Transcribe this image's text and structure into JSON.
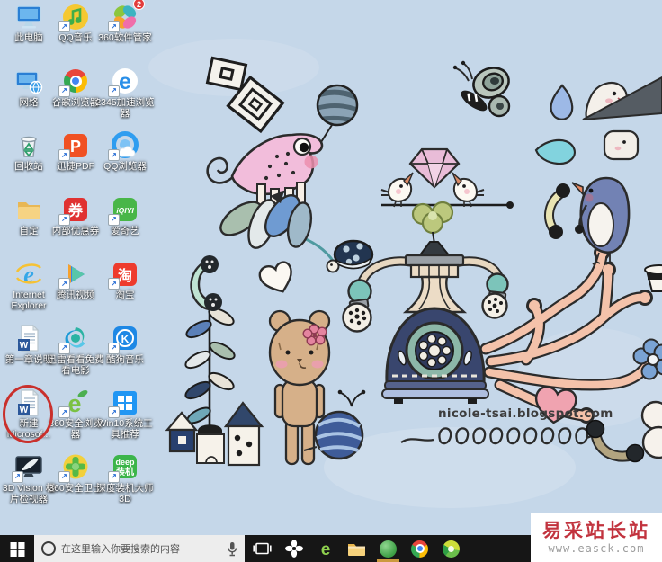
{
  "wallpaper": {
    "background_color": "#c5d7e9",
    "credit": "nicole-tsai.blogspot.com",
    "doodles": [
      "nested-squares",
      "striped-ball",
      "chameleon",
      "leaf-flower",
      "turtle",
      "butterfly",
      "diamond-gem",
      "love-birds",
      "pinwheel-flower",
      "blue-teardrop",
      "ghost",
      "dark-triangle",
      "teal-drop",
      "marshmallow",
      "penguin-with-handset",
      "octopus-tentacles",
      "rotary-telephone",
      "handset-plant",
      "small-houses",
      "white-heart",
      "teddy-bear",
      "yarn-ball",
      "phone-cord",
      "pink-heart",
      "tan-handset",
      "white-blob",
      "blue-flower",
      "cup"
    ]
  },
  "desktop": {
    "icons": [
      {
        "name": "this-pc",
        "label": "此电脑"
      },
      {
        "name": "qq-music",
        "label": "QQ音乐",
        "shortcut": true
      },
      {
        "name": "360-software-manager",
        "label": "360软件管家",
        "badge": "2",
        "shortcut": true
      },
      {
        "name": "network",
        "label": "网络"
      },
      {
        "name": "chrome",
        "label": "谷歌浏览器",
        "shortcut": true
      },
      {
        "name": "2345-browser",
        "label": "2345加速浏览器",
        "shortcut": true
      },
      {
        "name": "recycle-bin",
        "label": "回收站"
      },
      {
        "name": "pdf-converter",
        "label": "迅捷PDF",
        "shortcut": true
      },
      {
        "name": "qq-browser",
        "label": "QQ浏览器",
        "shortcut": true
      },
      {
        "name": "folder",
        "label": "自定"
      },
      {
        "name": "coupon",
        "label": "内部优惠券",
        "shortcut": true
      },
      {
        "name": "iqiyi",
        "label": "爱奇艺",
        "shortcut": true
      },
      {
        "name": "internet-explorer",
        "label": "Internet Explorer"
      },
      {
        "name": "tencent-video",
        "label": "腾讯视频",
        "shortcut": true
      },
      {
        "name": "taobao",
        "label": "淘宝",
        "shortcut": true
      },
      {
        "name": "word-doc",
        "label": "第一章说明"
      },
      {
        "name": "xunlei-kankan",
        "label": "迅雷看看免费看电影",
        "shortcut": true
      },
      {
        "name": "kugou-music",
        "label": "酷狗音乐",
        "shortcut": true
      },
      {
        "name": "new-word-doc",
        "label": "新建 Microsof..."
      },
      {
        "name": "360-browser",
        "label": "360安全浏览器",
        "shortcut": true
      },
      {
        "name": "win10-tools",
        "label": "Win10系统工具推荐",
        "shortcut": true
      },
      {
        "name": "3d-vision-viewer",
        "label": "3D Vision 相片检视器",
        "shortcut": true
      },
      {
        "name": "360-safe",
        "label": "360安全卫士",
        "shortcut": true
      },
      {
        "name": "deepin-installer",
        "label": "深度装机大师3D",
        "shortcut": true
      }
    ],
    "annotation": {
      "shape": "red-circle",
      "target": "new-word-doc"
    }
  },
  "glyphs": {
    "shortcut_arrow": "↗",
    "word_w": "W",
    "pdf_p": "P",
    "e_2345": "e",
    "e_ie": "e",
    "e_360": "e",
    "coupon_char": "券",
    "taobao_char": "淘",
    "iqiyi_text": "iQIYI",
    "kugou_k": "K",
    "deep_line1": "deep",
    "deep_line2": "装机"
  },
  "taskbar": {
    "background": "#161616",
    "search_placeholder": "在这里输入你要搜索的内容",
    "buttons": [
      "start",
      "search",
      "task-view",
      "pinwheel-browser",
      "360-browser-e",
      "file-explorer",
      "360-safety",
      "chrome",
      "360-antivirus"
    ],
    "active_button": "360-safety"
  },
  "watermark": {
    "title": "易采站长站",
    "url": "www.easck.com",
    "title_color": "#c2333e"
  }
}
